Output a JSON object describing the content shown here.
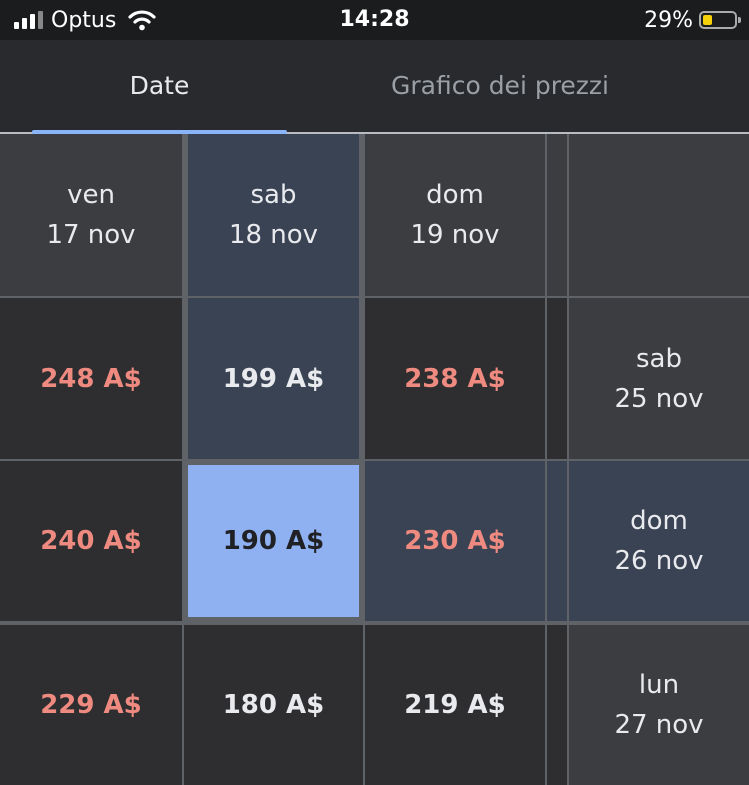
{
  "status_bar": {
    "carrier": "Optus",
    "time": "14:28",
    "battery_percent": "29%",
    "battery_level": 0.29,
    "battery_color": "#f5d10a",
    "icons": [
      "signal-icon",
      "wifi-icon",
      "battery-icon"
    ]
  },
  "tabs": [
    {
      "label": "Date",
      "selected": true
    },
    {
      "label": "Grafico dei prezzi",
      "selected": false
    }
  ],
  "colors": {
    "accent": "#8ab4f8",
    "price_high": "#ee8a80",
    "price_normal": "#e8eaed",
    "selected_cell": "#8fb1f2"
  },
  "columns": [
    {
      "day": "ven",
      "date": "17 nov"
    },
    {
      "day": "sab",
      "date": "18 nov"
    },
    {
      "day": "dom",
      "date": "19 nov"
    }
  ],
  "rows": [
    {
      "day": "sab",
      "date": "25 nov",
      "prices": [
        {
          "value": "248 A$",
          "level": "high"
        },
        {
          "value": "199 A$",
          "level": "normal"
        },
        {
          "value": "238 A$",
          "level": "high"
        }
      ]
    },
    {
      "day": "dom",
      "date": "26 nov",
      "prices": [
        {
          "value": "240 A$",
          "level": "high"
        },
        {
          "value": "190 A$",
          "level": "selected"
        },
        {
          "value": "230 A$",
          "level": "high"
        }
      ]
    },
    {
      "day": "lun",
      "date": "27 nov",
      "prices": [
        {
          "value": "229 A$",
          "level": "high"
        },
        {
          "value": "180 A$",
          "level": "normal"
        },
        {
          "value": "219 A$",
          "level": "normal"
        }
      ]
    }
  ]
}
